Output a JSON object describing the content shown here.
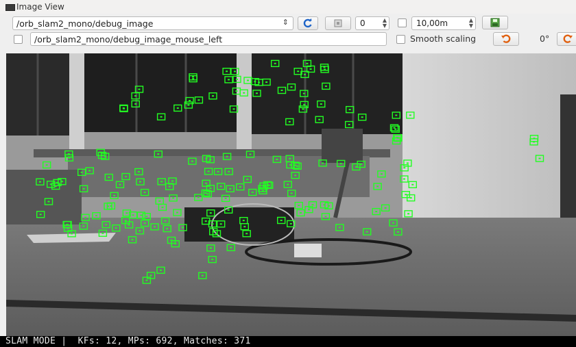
{
  "window": {
    "title": "Image View"
  },
  "toolbar": {
    "topic": "/orb_slam2_mono/debug_image",
    "refresh_icon": "refresh-icon",
    "camera_icon": "camera-icon",
    "index_value": "0",
    "zoom_value": "10,00m",
    "save_icon": "save-image-icon"
  },
  "mouse_row": {
    "mouse_topic": "/orb_slam2_mono/debug_image_mouse_left",
    "smooth_scaling_label": "Smooth scaling",
    "rotate_label": "0°",
    "rotate_left_icon": "rotate-left-icon",
    "rotate_right_icon": "rotate-right-icon"
  },
  "status": {
    "text": "SLAM MODE |  KFs: 12, MPs: 692, Matches: 371"
  },
  "colors": {
    "feature_marker": "#22ff22",
    "status_bg": "#000000",
    "accent_orange": "#e06010"
  }
}
